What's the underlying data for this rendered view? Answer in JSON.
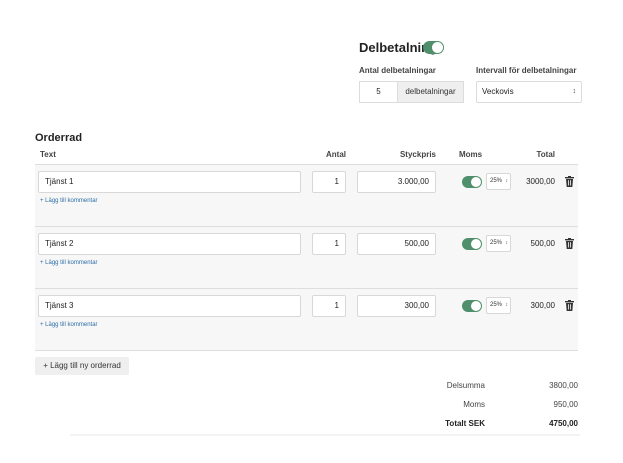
{
  "delbetalning": {
    "title": "Delbetalning",
    "toggle_on": true,
    "antal_label": "Antal delbetalningar",
    "antal_value": "5",
    "antal_addon": "delbetalningar",
    "intervall_label": "Intervall för delbetalningar",
    "intervall_value": "Veckovis"
  },
  "orderrad": {
    "title": "Orderrad",
    "headers": {
      "text": "Text",
      "antal": "Antal",
      "pris": "Styckpris",
      "moms": "Moms",
      "total": "Total"
    },
    "rows": [
      {
        "text": "Tjänst 1",
        "antal": "1",
        "pris": "3.000,00",
        "vat": "25%",
        "total": "3000,00",
        "comment": "+ Lägg till kommentar"
      },
      {
        "text": "Tjänst 2",
        "antal": "1",
        "pris": "500,00",
        "vat": "25%",
        "total": "500,00",
        "comment": "+ Lägg till kommentar"
      },
      {
        "text": "Tjänst 3",
        "antal": "1",
        "pris": "300,00",
        "vat": "25%",
        "total": "300,00",
        "comment": "+ Lägg till kommentar"
      }
    ],
    "add_label": "+ Lägg till ny orderrad"
  },
  "summary": {
    "delsumma_label": "Delsumma",
    "delsumma_value": "3800,00",
    "moms_label": "Moms",
    "moms_value": "950,00",
    "total_label": "Totalt SEK",
    "total_value": "4750,00"
  },
  "colors": {
    "toggle": "#4f8f6b",
    "link": "#2d6ea8",
    "row_bg": "#f7f7f7"
  }
}
